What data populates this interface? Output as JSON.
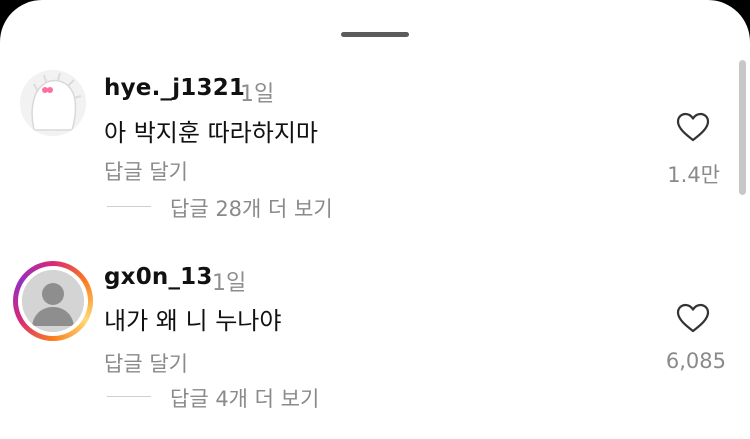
{
  "comments": [
    {
      "username": "hye._j1321",
      "time": "1일",
      "text": "아 박지훈 따라하지마",
      "reply_label": "답글 달기",
      "view_replies": "답글 28개 더 보기",
      "likes": "1.4만"
    },
    {
      "username": "gx0n_13",
      "time": "1일",
      "text": "내가 왜 니 누나야",
      "reply_label": "답글 달기",
      "view_replies": "답글 4개 더 보기",
      "likes": "6,085"
    }
  ],
  "icons": {
    "like": "heart-icon",
    "default_avatar": "person-icon"
  },
  "colors": {
    "story_ring": "#d62976",
    "secondary_text": "#8a8a8a"
  }
}
